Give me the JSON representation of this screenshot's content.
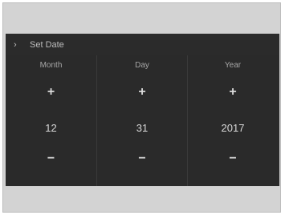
{
  "header": {
    "title": "Set Date",
    "chevron_icon": "chevron-right-icon"
  },
  "fields": {
    "month": {
      "label": "Month",
      "value": "12",
      "increment_icon": "plus-icon",
      "decrement_icon": "minus-icon"
    },
    "day": {
      "label": "Day",
      "value": "31",
      "increment_icon": "plus-icon",
      "decrement_icon": "minus-icon"
    },
    "year": {
      "label": "Year",
      "value": "2017",
      "increment_icon": "plus-icon",
      "decrement_icon": "minus-icon"
    }
  },
  "colors": {
    "background": "#2b2b2b",
    "text": "#d8d8d8",
    "muted_text": "#a6a6a6"
  }
}
